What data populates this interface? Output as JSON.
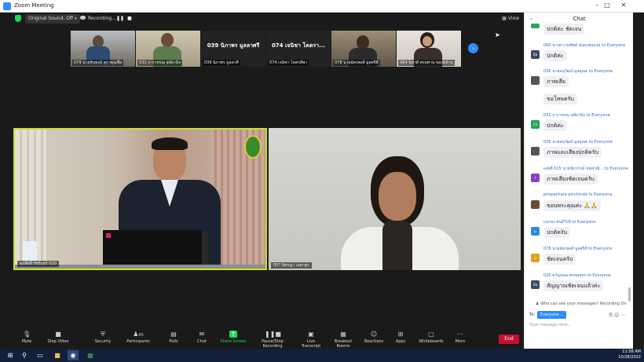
{
  "window": {
    "title": "Zoom Meeting",
    "minimize": "–",
    "maximize": "□",
    "close": "✕"
  },
  "topbar": {
    "original_sound": "Original Sound: Off",
    "recording": "Recording...",
    "pause": "❚❚",
    "stop": "■",
    "view": "View"
  },
  "thumbnails": [
    {
      "name": "079 นายทินพงษ์ สุภาคุณชื่อ",
      "video": true
    },
    {
      "name": "031 จาราทรณ จุฬอานิจ",
      "video": true
    },
    {
      "name": "039 นิภาพร มูลลาศี",
      "big": "039 นิภาพร มูลลาศรี",
      "video": false
    },
    {
      "name": "074 เจนิชา โคตรสีพา",
      "big": "074 เจนิชา โคตรา...",
      "video": false
    },
    {
      "name": "078 นายฉัตรพงศ์ มูลศรีดี",
      "video": true
    },
    {
      "name": "064 นิชาดี พรมศาน ของนิชำม",
      "video": true
    }
  ],
  "next_icon": "›",
  "tiles": [
    {
      "name": "ศุภสิทธิ์ วัชรินทร์ 020"
    },
    {
      "name": "057 อิศรญา เมตาศูร"
    }
  ],
  "toolbar": {
    "mute": "Mute",
    "stop_video": "Stop Video",
    "security": "Security",
    "participants": "Participants",
    "participants_count": "45",
    "polls": "Polls",
    "chat": "Chat",
    "share_screen": "Share Screen",
    "pause_stop_recording": "Pause/Stop Recording",
    "live_transcript": "Live Transcript",
    "breakout_rooms": "Breakout Rooms",
    "reactions": "Reactions",
    "apps": "Apps",
    "whiteboards": "Whiteboards",
    "more": "More",
    "end": "End"
  },
  "chat": {
    "title": "Chat",
    "messages": [
      {
        "from": "",
        "text": "ปกติค่ะ ชัดเจน",
        "avatar": "",
        "color": "#29a35a"
      },
      {
        "from": "060 นางสาวรุ่งทิพย์ สนองชนบุรุษ to Everyone",
        "text": "ปกติค่ะ",
        "avatar": "Da",
        "color": "#3b4a5e"
      },
      {
        "from": "036 นายอนุวัฒน์ มูลอุณต to Everyone",
        "text": "ภาพเสีย",
        "avatar": "",
        "color": "#555"
      },
      {
        "from": "",
        "text": "ขอโทษครับ",
        "avatar": "",
        "color": ""
      },
      {
        "from": "031 จาราทรณ จุฬอานิจ to Everyone",
        "text": "ปกติค่ะ",
        "avatar": "Ch",
        "color": "#29a35a"
      },
      {
        "from": "036 นายอนุวัฒน์ มูลอุณต to Everyone",
        "text": "ภาพและเสียงปกติครับ",
        "avatar": "",
        "color": "#555"
      },
      {
        "from": "เลขที่ 015 นายชัยวรรณ์ ชลพาณิ... to Everyone",
        "text": "ภาพเสียงชัดเจนครับ",
        "avatar": "I",
        "color": "#8a3fc7"
      },
      {
        "from": "pimpachara pinchinda to Everyone",
        "text": "ขอบพระคุณค่ะ 🙏🙏",
        "avatar": "",
        "color": "#6a4a3a"
      },
      {
        "from": "แจกจง คันธ์วีรดี to Everyone",
        "text": "ปกติครับ",
        "avatar": "แ",
        "color": "#2a8ae0"
      },
      {
        "from": "078 นายฉัตรพงศ์ มูลศรีดี to Everyone",
        "text": "ชัดเจนครับ",
        "avatar": "อ",
        "color": "#e0a020"
      },
      {
        "from": "020 ขวัญกมล พรหมสุทร to Everyone",
        "text": "สัญญาณชัดเจนแล้วค่ะ",
        "avatar": "Da",
        "color": "#3b4a5e"
      }
    ],
    "who_can_see": "Who can see your messages? Recording On",
    "to_label": "To:",
    "to_value": "Everyone ⌄",
    "placeholder": "Type message here..."
  },
  "taskbar": {
    "time": "11:58 AM",
    "date": "10/28/2022"
  }
}
